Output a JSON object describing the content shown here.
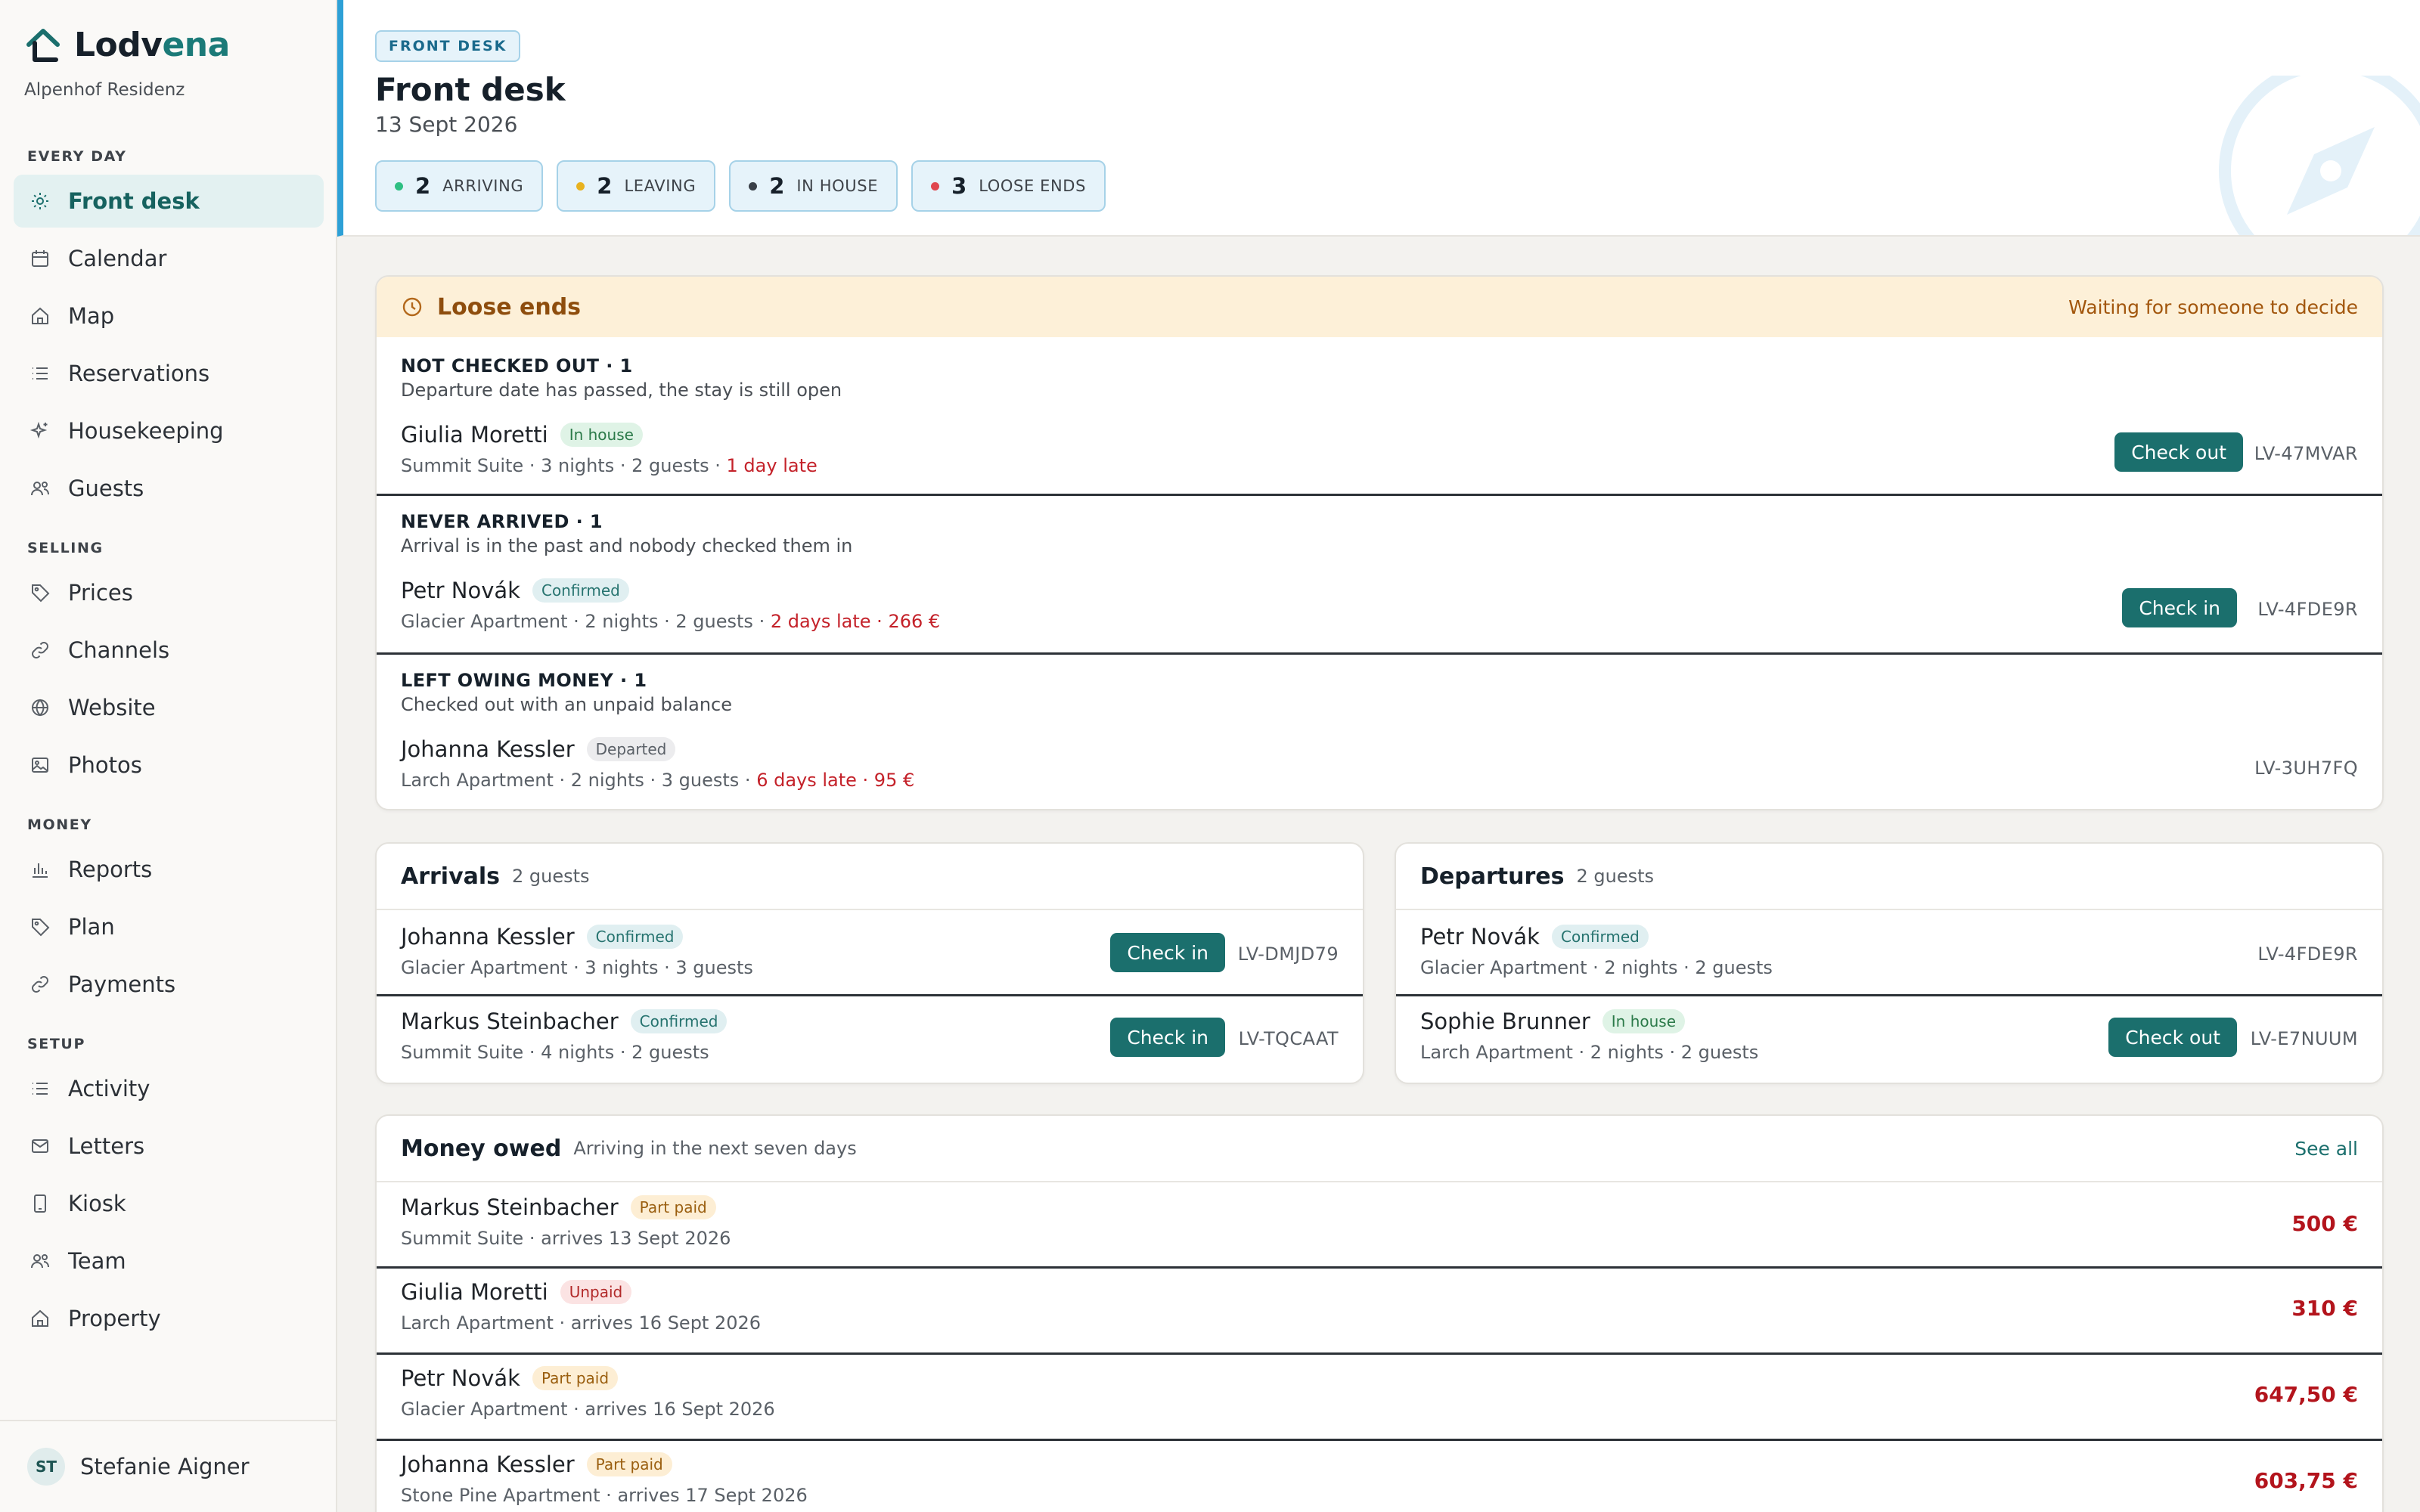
{
  "app": {
    "name_prefix": "Lodv",
    "name_suffix": "ena",
    "property": "Alpenhof Residenz"
  },
  "sidebar": {
    "sections": {
      "every_day": "EVERY DAY",
      "selling": "SELLING",
      "money": "MONEY",
      "setup": "SETUP"
    },
    "items": [
      {
        "label": "Front desk",
        "icon": "sun-icon",
        "active": true
      },
      {
        "label": "Calendar",
        "icon": "calendar-icon"
      },
      {
        "label": "Map",
        "icon": "home-icon"
      },
      {
        "label": "Reservations",
        "icon": "list-icon"
      },
      {
        "label": "Housekeeping",
        "icon": "sparkle-icon"
      },
      {
        "label": "Guests",
        "icon": "users-icon"
      },
      {
        "label": "Prices",
        "icon": "tag-icon"
      },
      {
        "label": "Channels",
        "icon": "link-icon"
      },
      {
        "label": "Website",
        "icon": "globe-icon"
      },
      {
        "label": "Photos",
        "icon": "image-icon"
      },
      {
        "label": "Reports",
        "icon": "bar-chart-icon"
      },
      {
        "label": "Plan",
        "icon": "tag-icon"
      },
      {
        "label": "Payments",
        "icon": "link-icon"
      },
      {
        "label": "Activity",
        "icon": "list-icon"
      },
      {
        "label": "Letters",
        "icon": "mail-icon"
      },
      {
        "label": "Kiosk",
        "icon": "tablet-icon"
      },
      {
        "label": "Team",
        "icon": "users-icon"
      },
      {
        "label": "Property",
        "icon": "home-icon"
      }
    ],
    "user": {
      "initials": "ST",
      "name": "Stefanie Aigner"
    }
  },
  "header": {
    "eyebrow": "FRONT DESK",
    "title": "Front desk",
    "date": "13 Sept 2026",
    "stats": [
      {
        "count": "2",
        "label": "ARRIVING",
        "color": "#2fbf83"
      },
      {
        "count": "2",
        "label": "LEAVING",
        "color": "#e8b21f"
      },
      {
        "count": "2",
        "label": "IN HOUSE",
        "color": "#3a4048"
      },
      {
        "count": "3",
        "label": "LOOSE ENDS",
        "color": "#e0474f"
      }
    ]
  },
  "loose_ends": {
    "title": "Loose ends",
    "status": "Waiting for someone to decide",
    "groups": [
      {
        "label": "NOT CHECKED OUT · 1",
        "description": "Departure date has passed, the stay is still open",
        "guest": "Giulia Moretti",
        "badge": "In house",
        "meta": "Summit Suite · 3 nights · 2 guests · ",
        "late": "1 day late",
        "action": "Check out",
        "ref": "LV-47MVAR"
      },
      {
        "label": "NEVER ARRIVED · 1",
        "description": "Arrival is in the past and nobody checked them in",
        "guest": "Petr Novák",
        "badge": "Confirmed",
        "meta": "Glacier Apartment · 2 nights · 2 guests · ",
        "late": "2 days late · 266 €",
        "action": "Check in",
        "ref": "LV-4FDE9R"
      },
      {
        "label": "LEFT OWING MONEY · 1",
        "description": "Checked out with an unpaid balance",
        "guest": "Johanna Kessler",
        "badge": "Departed",
        "meta": "Larch Apartment · 2 nights · 3 guests · ",
        "late": "6 days late · 95 €",
        "ref": "LV-3UH7FQ"
      }
    ]
  },
  "arrivals": {
    "title": "Arrivals",
    "subtitle": "2 guests",
    "rows": [
      {
        "guest": "Johanna Kessler",
        "badge": "Confirmed",
        "meta": "Glacier Apartment · 3 nights · 3 guests",
        "action": "Check in",
        "ref": "LV-DMJD79"
      },
      {
        "guest": "Markus Steinbacher",
        "badge": "Confirmed",
        "meta": "Summit Suite · 4 nights · 2 guests",
        "action": "Check in",
        "ref": "LV-TQCAAT"
      }
    ]
  },
  "departures": {
    "title": "Departures",
    "subtitle": "2 guests",
    "rows": [
      {
        "guest": "Petr Novák",
        "badge": "Confirmed",
        "meta": "Glacier Apartment · 2 nights · 2 guests",
        "ref": "LV-4FDE9R"
      },
      {
        "guest": "Sophie Brunner",
        "badge": "In house",
        "meta": "Larch Apartment · 2 nights · 2 guests",
        "action": "Check out",
        "ref": "LV-E7NUUM"
      }
    ]
  },
  "money_owed": {
    "title": "Money owed",
    "subtitle": "Arriving in the next seven days",
    "link": "See all",
    "rows": [
      {
        "guest": "Markus Steinbacher",
        "badge": "Part paid",
        "meta": "Summit Suite · arrives 13 Sept 2026",
        "amount": "500 €"
      },
      {
        "guest": "Giulia Moretti",
        "badge": "Unpaid",
        "meta": "Larch Apartment · arrives 16 Sept 2026",
        "amount": "310 €"
      },
      {
        "guest": "Petr Novák",
        "badge": "Part paid",
        "meta": "Glacier Apartment · arrives 16 Sept 2026",
        "amount": "647,50 €"
      },
      {
        "guest": "Johanna Kessler",
        "badge": "Part paid",
        "meta": "Stone Pine Apartment · arrives 17 Sept 2026",
        "amount": "603,75 €"
      }
    ]
  }
}
